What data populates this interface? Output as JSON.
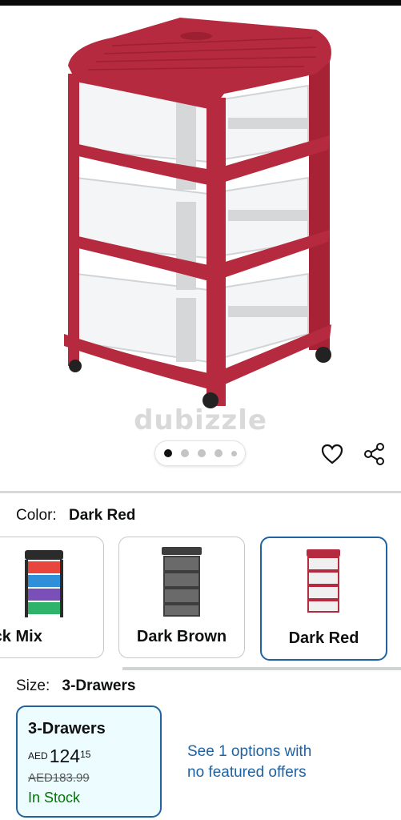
{
  "watermark": "dubizzle",
  "carousel": {
    "count": 5,
    "active_index": 0
  },
  "actions": {
    "favorite_icon": "heart-icon",
    "share_icon": "share-icon"
  },
  "color": {
    "label": "Color:",
    "selected": "Dark Red",
    "options": [
      {
        "name": "lack Mix",
        "colors": [
          "#2b2b2b",
          "#e8463c",
          "#2f8fd8",
          "#7b4fb8",
          "#2fb36a"
        ]
      },
      {
        "name": "Dark Brown",
        "colors": [
          "#4a4a4a"
        ]
      },
      {
        "name": "Dark Red",
        "colors": [
          "#b52a3e"
        ]
      }
    ]
  },
  "size": {
    "label": "Size:",
    "selected": "3-Drawers",
    "card": {
      "title": "3-Drawers",
      "currency": "AED",
      "price_whole": "124",
      "price_fraction": "15",
      "was_price": "AED183.99",
      "stock": "In Stock"
    },
    "more_options_line1": "See 1 options with",
    "more_options_line2": "no featured offers"
  },
  "colors": {
    "frame_red": "#b52a3e",
    "link_blue": "#2162a1",
    "stock_green": "#007600"
  }
}
